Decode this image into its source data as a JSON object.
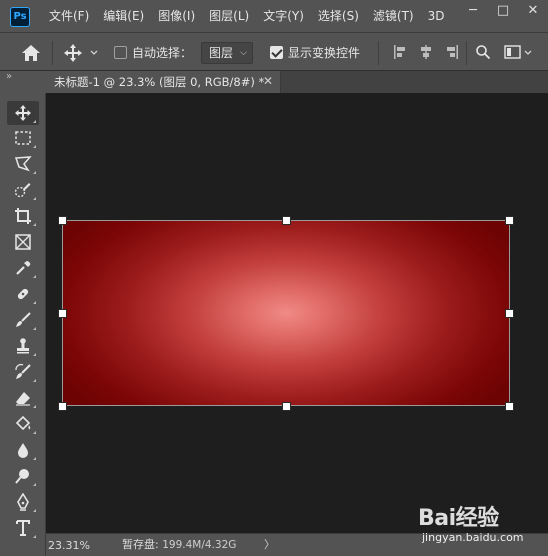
{
  "app": {
    "logo_text": "Ps"
  },
  "menu": {
    "items": [
      {
        "label": "文件(F)"
      },
      {
        "label": "编辑(E)"
      },
      {
        "label": "图像(I)"
      },
      {
        "label": "图层(L)"
      },
      {
        "label": "文字(Y)"
      },
      {
        "label": "选择(S)"
      },
      {
        "label": "滤镜(T)"
      },
      {
        "label": "3D"
      }
    ]
  },
  "window_controls": {
    "minimize": "─",
    "maximize": "□",
    "close": "✕"
  },
  "options_bar": {
    "auto_select_label": "自动选择：",
    "auto_select_checked": false,
    "auto_select_target": "图层",
    "show_transform_label": "显示变换控件",
    "show_transform_checked": true
  },
  "panel_collapse": "»",
  "document_tab": {
    "title": "未标题-1 @ 23.3% (图层 0, RGB/8#) *",
    "close": "✕"
  },
  "tools": [
    {
      "name": "move-tool",
      "icon": "move-icon",
      "active": true
    },
    {
      "name": "marquee-tool",
      "icon": "rect-marquee-icon"
    },
    {
      "name": "lasso-tool",
      "icon": "polygon-lasso-icon"
    },
    {
      "name": "quick-select-tool",
      "icon": "quick-select-icon"
    },
    {
      "name": "crop-tool",
      "icon": "crop-icon"
    },
    {
      "name": "frame-tool",
      "icon": "frame-icon"
    },
    {
      "name": "eyedropper-tool",
      "icon": "eyedropper-icon"
    },
    {
      "name": "healing-tool",
      "icon": "healing-brush-icon"
    },
    {
      "name": "brush-tool",
      "icon": "brush-icon"
    },
    {
      "name": "stamp-tool",
      "icon": "clone-stamp-icon"
    },
    {
      "name": "history-brush-tool",
      "icon": "history-brush-icon"
    },
    {
      "name": "eraser-tool",
      "icon": "eraser-icon"
    },
    {
      "name": "paint-bucket-tool",
      "icon": "paint-bucket-icon"
    },
    {
      "name": "blur-tool",
      "icon": "blur-drop-icon"
    },
    {
      "name": "dodge-tool",
      "icon": "dodge-icon"
    },
    {
      "name": "pen-tool",
      "icon": "pen-icon"
    },
    {
      "name": "type-tool",
      "icon": "type-icon"
    }
  ],
  "colors": {
    "ui_bg": "#535353",
    "workspace_bg": "#1e1e1e",
    "accent": "#31a8ff",
    "art_center": "#f08a85",
    "art_edge": "#6e0303"
  },
  "status_bar": {
    "zoom": "23.31%",
    "scratch_label": "暂存盘:",
    "scratch_value": "199.4M/4.32G",
    "arrow": "〉"
  },
  "watermark": {
    "brand": "Bai经验",
    "url": "jingyan.baidu.com"
  }
}
